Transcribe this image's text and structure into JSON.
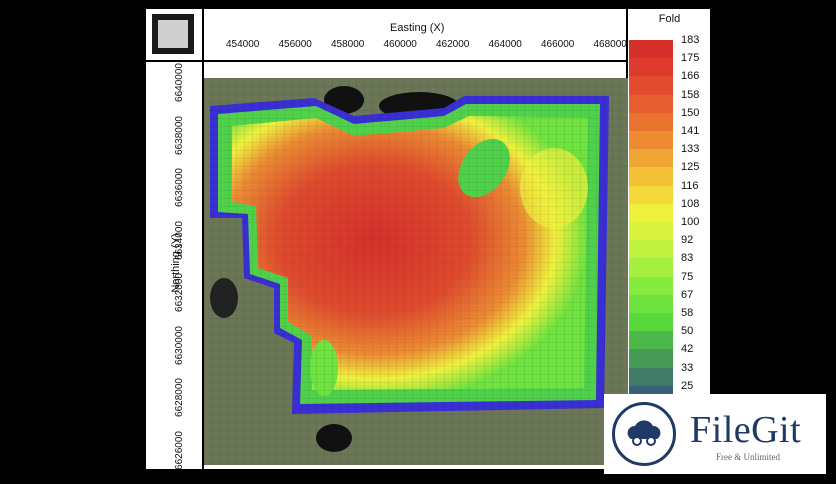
{
  "app": {
    "x_axis_title": "Easting (X)",
    "y_axis_title": "Northing (Y)",
    "x_ticks": [
      "454000",
      "456000",
      "458000",
      "460000",
      "462000",
      "464000",
      "466000",
      "468000"
    ],
    "y_ticks": [
      "6640000",
      "6638000",
      "6636000",
      "6634000",
      "6632000",
      "6630000",
      "6628000",
      "6626000"
    ]
  },
  "legend": {
    "title": "Fold",
    "items": [
      {
        "label": "183",
        "color": "#d7302b"
      },
      {
        "label": "175",
        "color": "#dc3a2c"
      },
      {
        "label": "166",
        "color": "#e24b2e"
      },
      {
        "label": "158",
        "color": "#e65d2f"
      },
      {
        "label": "150",
        "color": "#ea7330"
      },
      {
        "label": "141",
        "color": "#ec8b32"
      },
      {
        "label": "133",
        "color": "#efa534"
      },
      {
        "label": "125",
        "color": "#f2c036"
      },
      {
        "label": "116",
        "color": "#f4d83a"
      },
      {
        "label": "108",
        "color": "#eef03c"
      },
      {
        "label": "100",
        "color": "#d9f43e"
      },
      {
        "label": "92",
        "color": "#c0f23f"
      },
      {
        "label": "83",
        "color": "#a4ef3f"
      },
      {
        "label": "75",
        "color": "#86ea3f"
      },
      {
        "label": "67",
        "color": "#6ee23e"
      },
      {
        "label": "58",
        "color": "#58d83d"
      },
      {
        "label": "50",
        "color": "#4cb84a"
      },
      {
        "label": "42",
        "color": "#479a55"
      },
      {
        "label": "33",
        "color": "#417c68"
      },
      {
        "label": "25",
        "color": "#3a5f7c"
      }
    ]
  },
  "watermark": {
    "name": "FileGit",
    "tagline": "Free & Unlimited",
    "brand_color": "#1f3a66"
  }
}
